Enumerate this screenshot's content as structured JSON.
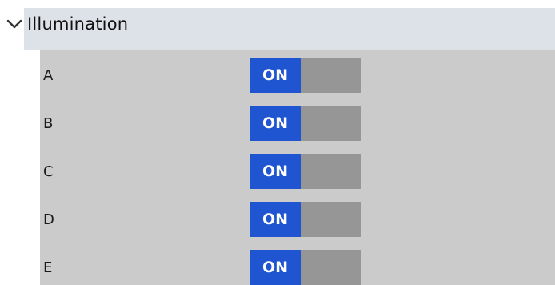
{
  "section": {
    "title": "Illumination",
    "expanded": true,
    "icon": "chevron-down-icon"
  },
  "items": [
    {
      "label": "A",
      "state": "ON"
    },
    {
      "label": "B",
      "state": "ON"
    },
    {
      "label": "C",
      "state": "ON"
    },
    {
      "label": "D",
      "state": "ON"
    },
    {
      "label": "E",
      "state": "ON"
    }
  ],
  "colors": {
    "header_bg": "#dde1e8",
    "panel_bg": "#cbcbcb",
    "toggle_on": "#1f55d1",
    "toggle_track": "#969696"
  }
}
